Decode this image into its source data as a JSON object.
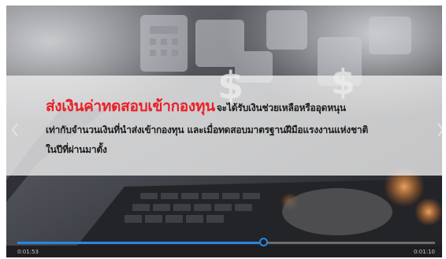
{
  "video": {
    "caption": {
      "highlight": "ส่งเงินค่าทดสอบเข้ากองทุน",
      "line1_rest": "จะได้รับเงินช่วยเหลือหรืออุดหนุน",
      "line2": "เท่ากับจำนวนเงินที่นำส่งเข้ากองทุน และเมื่อทดสอบมาตรฐานฝีมือแรงงานแห่งชาติ",
      "line3": "ในปีที่ผ่านมาตั้ง"
    },
    "highlight_color": "#ea1f26",
    "accent_color": "#2a86e2"
  },
  "player": {
    "current_time": "0:01:53",
    "total_time": "0:01:10",
    "progress": 0.59
  },
  "icons": {
    "prev": "chevron-left-icon",
    "next": "chevron-right-icon"
  }
}
